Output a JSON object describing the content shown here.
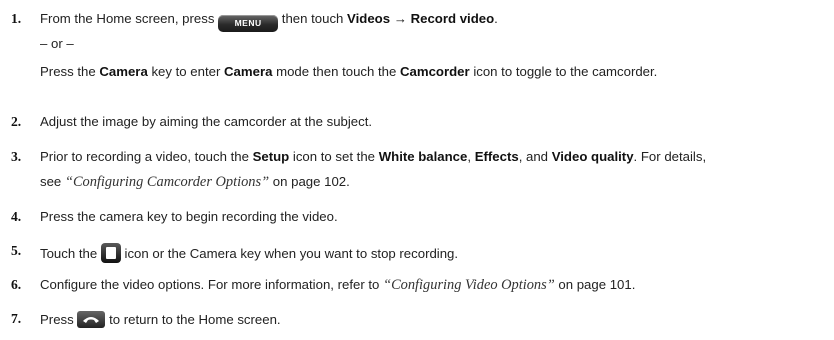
{
  "keys": {
    "menu_label": "MENU"
  },
  "steps": [
    {
      "number": "1.",
      "line1": {
        "t1": "From the Home screen, press",
        "t2": "then touch",
        "b1": "Videos",
        "arrow": "→",
        "b2": "Record video",
        "t3": "."
      },
      "or_text": "– or –",
      "line3": {
        "t1": "Press the",
        "b1": "Camera",
        "t2": "key to enter",
        "b2": "Camera",
        "t3": "mode then touch the",
        "b3": "Camcorder",
        "t4": "icon to toggle to the camcorder."
      }
    },
    {
      "number": "2.",
      "text": "Adjust the image by aiming the camcorder at the subject."
    },
    {
      "number": "3.",
      "line1": {
        "t1": "Prior to recording a video, touch the",
        "b1": "Setup",
        "t2": "icon to set the",
        "b2": "White balance",
        "t3": ",",
        "b3": "Effects",
        "t4": ", and",
        "b4": "Video quality",
        "t5": ". For details,"
      },
      "line2": {
        "t1": "see",
        "ref": "“Configuring Camcorder Options”",
        "t2": "on page 102."
      }
    },
    {
      "number": "4.",
      "text": "Press the camera key to begin recording the video."
    },
    {
      "number": "5.",
      "t1": "Touch the",
      "t2": "icon or the Camera key when you want to stop recording."
    },
    {
      "number": "6.",
      "t1": "Configure the video options. For more information, refer to",
      "ref": "“Configuring Video Options”",
      "t2": "on page 101."
    },
    {
      "number": "7.",
      "t1": "Press",
      "t2": "to return to the Home screen."
    }
  ]
}
